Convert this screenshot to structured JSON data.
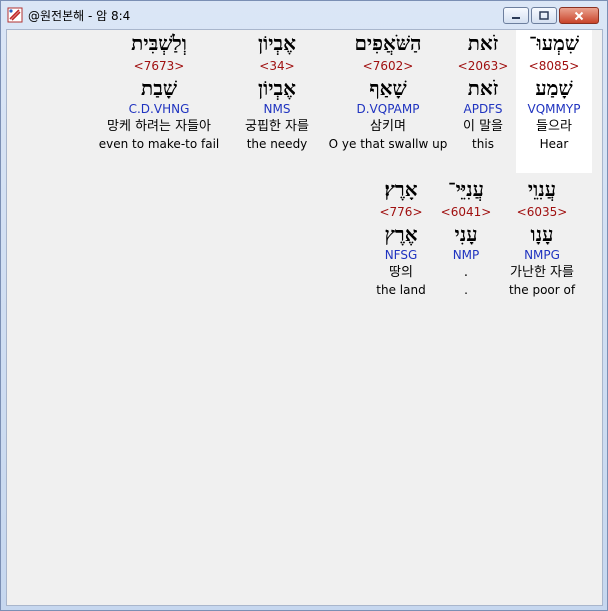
{
  "window": {
    "title": "@원전본해 - 암 8:4"
  },
  "rows": [
    {
      "words": [
        {
          "hebrew": "שִׁמְעוּ־",
          "strong": "<8085>",
          "lemma": "שָׁמַע",
          "morph": "VQMMYP",
          "korean": "들으라",
          "english": "Hear",
          "selected": true
        },
        {
          "hebrew": "זֹאת",
          "strong": "<2063>",
          "lemma": "זֹאת",
          "morph": "APDFS",
          "korean": "이 말을",
          "english": "this",
          "selected": false
        },
        {
          "hebrew": "הַשֹּׁאֲפִים",
          "strong": "<7602>",
          "lemma": "שָׁאַף",
          "morph": "D.VQPAMP",
          "korean": "삼키며",
          "english": "O ye that swallw up",
          "selected": false
        },
        {
          "hebrew": "אֶבְיוֹן",
          "strong": "<34>",
          "lemma": "אֶבְיוֹן",
          "morph": "NMS",
          "korean": "궁핍한 자를",
          "english": "the needy",
          "selected": false
        },
        {
          "hebrew": "וְלַשְׁבִּית",
          "strong": "<7673>",
          "lemma": "שָׁבַת",
          "morph": "C.D.VHNG",
          "korean": "망케 하려는 자들아",
          "english": "even to make-to fail",
          "selected": false
        }
      ]
    },
    {
      "words": [
        {
          "hebrew": "עֲנִוֵי",
          "strong": "<6035>",
          "lemma": "עָנָו",
          "morph": "NMPG",
          "korean": "가난한 자를",
          "english": "the poor of",
          "selected": false
        },
        {
          "hebrew": "עֲנִיֵּי־",
          "strong": "<6041>",
          "lemma": "עָנִי",
          "morph": "NMP",
          "korean": ".",
          "english": ".",
          "selected": false
        },
        {
          "hebrew": "אָרֶץ׃",
          "strong": "<776>",
          "lemma": "אֶרֶץ",
          "morph": "NFSG",
          "korean": "땅의",
          "english": "the land",
          "selected": false
        }
      ]
    }
  ]
}
